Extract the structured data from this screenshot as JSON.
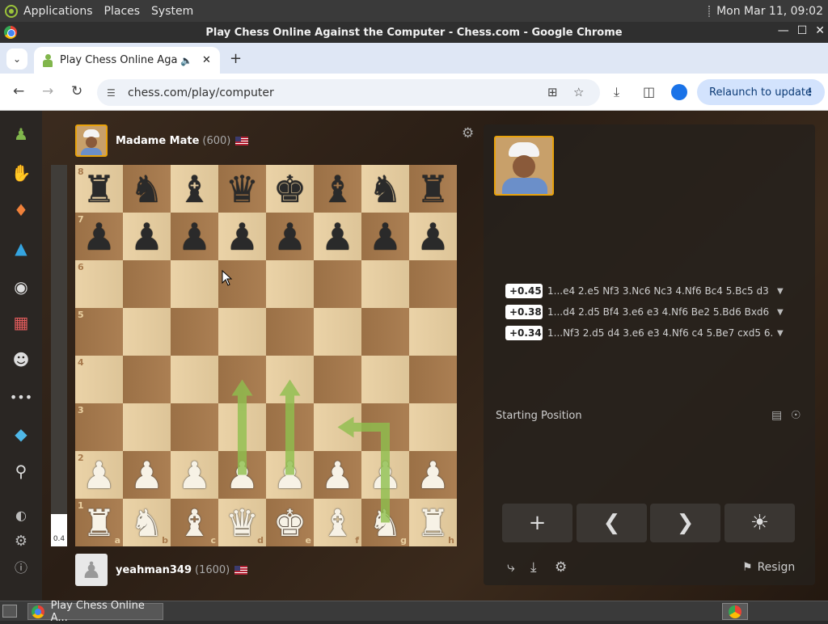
{
  "os": {
    "menu": [
      "Applications",
      "Places",
      "System"
    ],
    "clock": "Mon Mar 11, 09:02"
  },
  "window": {
    "title": "Play Chess Online Against the Computer - Chess.com - Google Chrome"
  },
  "tab": {
    "title": "Play Chess Online Agains",
    "close": "✕",
    "new_tab": "+"
  },
  "toolbar": {
    "url": "chess.com/play/computer",
    "relaunch": "Relaunch to update"
  },
  "players": {
    "top": {
      "name": "Madame Mate",
      "rating": "(600)"
    },
    "bottom": {
      "name": "yeahman349",
      "rating": "(1600)"
    }
  },
  "eval": {
    "value": "0.4",
    "white_fraction": 0.085
  },
  "board": {
    "ranks": [
      "8",
      "7",
      "6",
      "5",
      "4",
      "3",
      "2",
      "1"
    ],
    "files": [
      "a",
      "b",
      "c",
      "d",
      "e",
      "f",
      "g",
      "h"
    ],
    "position": [
      [
        "r",
        "n",
        "b",
        "q",
        "k",
        "b",
        "n",
        "r"
      ],
      [
        "p",
        "p",
        "p",
        "p",
        "p",
        "p",
        "p",
        "p"
      ],
      [
        "",
        "",
        "",
        "",
        "",
        "",
        "",
        ""
      ],
      [
        "",
        "",
        "",
        "",
        "",
        "",
        "",
        ""
      ],
      [
        "",
        "",
        "",
        "",
        "",
        "",
        "",
        ""
      ],
      [
        "",
        "",
        "",
        "",
        "",
        "",
        "",
        ""
      ],
      [
        "P",
        "P",
        "P",
        "P",
        "P",
        "P",
        "P",
        "P"
      ],
      [
        "R",
        "N",
        "B",
        "Q",
        "K",
        "B",
        "N",
        "R"
      ]
    ],
    "arrows": [
      {
        "from": "d2",
        "to": "d4"
      },
      {
        "from": "e2",
        "to": "e4"
      },
      {
        "from": "g1",
        "to": "f3"
      }
    ],
    "arrow_color": "#8fbf4e"
  },
  "engine_lines": [
    {
      "score": "+0.45",
      "moves": "1...e4 2.e5 Nf3 3.Nc6 Nc3 4.Nf6 Bc4 5.Bc5 d3 …"
    },
    {
      "score": "+0.38",
      "moves": "1...d4 2.d5 Bf4 3.e6 e3 4.Nf6 Be2 5.Bd6 Bxd6 …"
    },
    {
      "score": "+0.34",
      "moves": "1...Nf3 2.d5 d4 3.e6 e3 4.Nf6 c4 5.Be7 cxd5 6.…"
    }
  ],
  "status": {
    "starting_position": "Starting Position"
  },
  "actions": {
    "resign": "Resign"
  },
  "taskbar": {
    "item": "Play Chess Online A..."
  }
}
